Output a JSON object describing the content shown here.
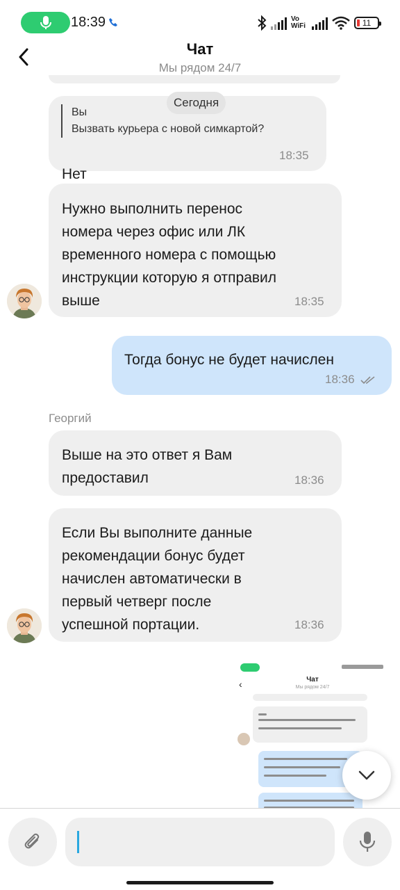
{
  "status_bar": {
    "time": "18:39",
    "network_label": "Vo\nWiFi",
    "battery": "11"
  },
  "header": {
    "title": "Чат",
    "subtitle": "Мы рядом 24/7"
  },
  "chat": {
    "date_separator": "Сегодня",
    "messages": [
      {
        "direction": "incoming",
        "quote_author": "Вы",
        "quote_text": "Вызвать курьера с новой симкартой?",
        "text": "Нет",
        "time": "18:35"
      },
      {
        "direction": "incoming",
        "lines": [
          "Нужно выполнить перенос",
          "номера через офис или ЛК",
          "временного номера с помощью",
          "инструкции которую я отправил",
          "выше"
        ],
        "time": "18:35"
      },
      {
        "direction": "outgoing",
        "text": "Тогда бонус не будет начислен",
        "time": "18:36",
        "status": "read"
      },
      {
        "direction": "incoming",
        "sender": "Георгий",
        "lines": [
          "Выше на это ответ я Вам",
          "предоставил"
        ],
        "time": "18:36"
      },
      {
        "direction": "incoming",
        "lines": [
          "Если Вы выполните данные",
          "рекомендации бонус будет",
          "начислен автоматически в",
          "первый четверг после",
          "успешной портации."
        ],
        "time": "18:36"
      }
    ],
    "attachment": {
      "type": "screenshot-image",
      "title": "Чат",
      "subtitle": "Мы рядом 24/7"
    }
  },
  "composer": {
    "input_value": "",
    "input_placeholder": ""
  },
  "colors": {
    "incoming_bubble": "#efefef",
    "outgoing_bubble": "#cfe5fb",
    "accent_green": "#2ecc71",
    "caret": "#29a8e0",
    "battery_low": "#e53935"
  },
  "icons": [
    "mic-icon",
    "call-icon",
    "bluetooth-icon",
    "signal-icon",
    "wifi-icon",
    "battery-icon",
    "back-arrow-icon",
    "double-check-icon",
    "chevron-down-icon",
    "paperclip-icon",
    "microphone-icon"
  ]
}
